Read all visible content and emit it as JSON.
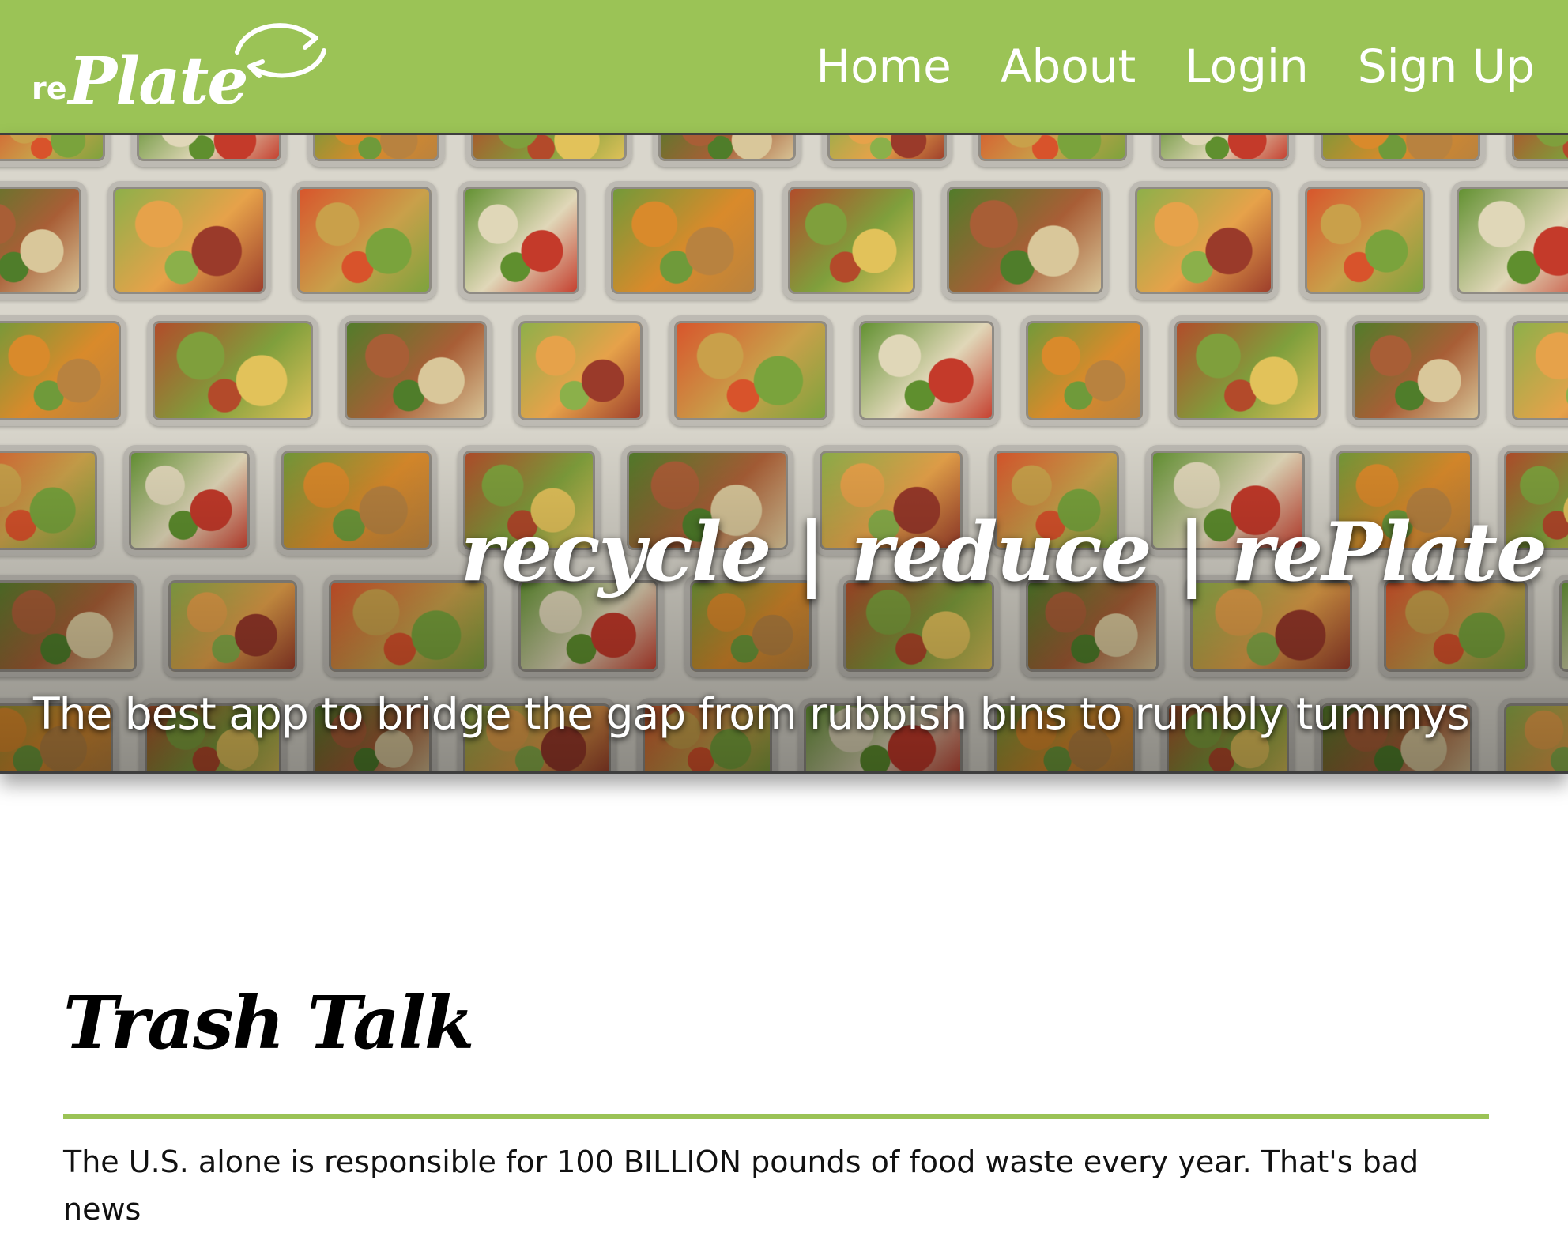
{
  "header": {
    "logo_prefix": "re",
    "logo_main": "Plate",
    "nav": [
      {
        "label": "Home"
      },
      {
        "label": "About"
      },
      {
        "label": "Login"
      },
      {
        "label": "Sign Up"
      }
    ]
  },
  "hero": {
    "tagline": "recycle | reduce | rePlate",
    "subtitle": "The best app to bridge the gap from rubbish bins to rumbly tummys"
  },
  "section": {
    "title": "Trash Talk",
    "body": "The U.S. alone is responsible for 100 BILLION pounds of food waste every year. That's bad news"
  },
  "colors": {
    "brand_green": "#9bc356",
    "text": "#000000",
    "white": "#ffffff"
  }
}
